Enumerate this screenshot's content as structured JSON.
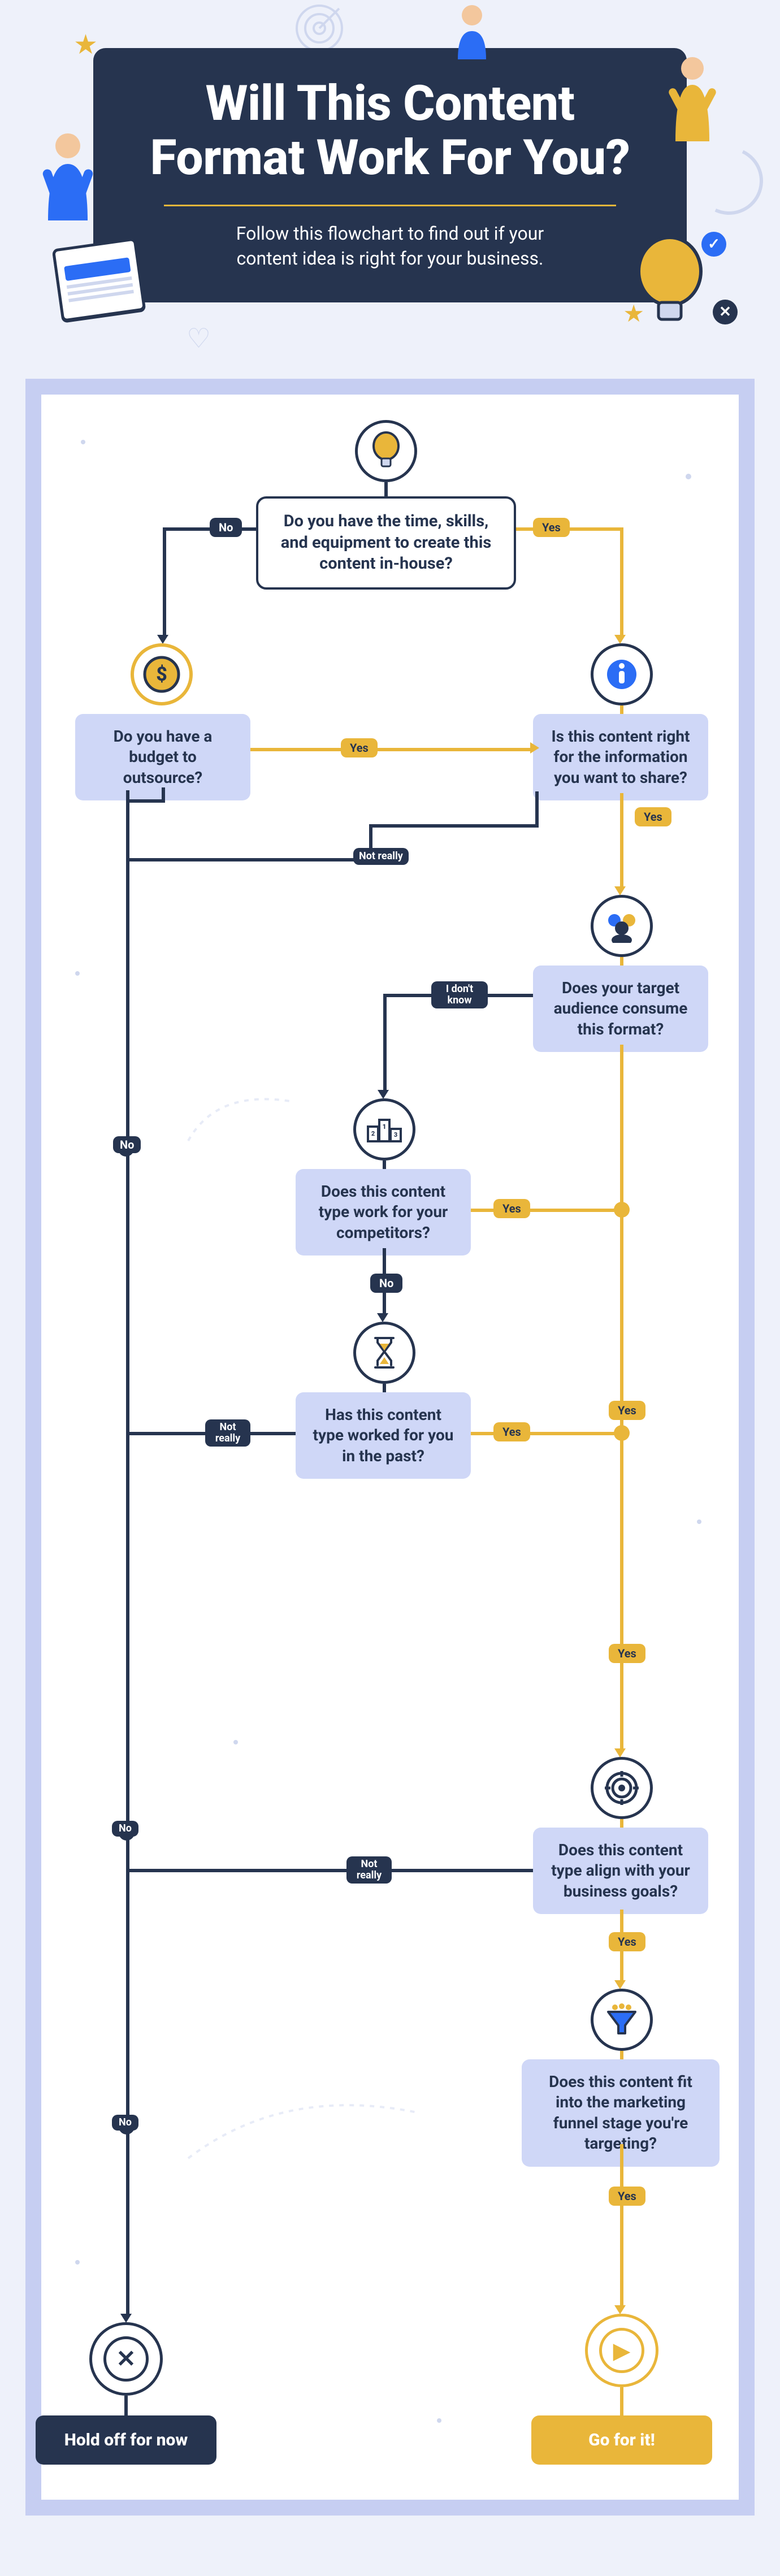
{
  "header": {
    "title_line1": "Will This Content",
    "title_line2": "Format Work For You?",
    "subtitle_line1": "Follow this flowchart to find out if your",
    "subtitle_line2": "content idea is right for your business."
  },
  "nodes": {
    "start": "Do you have the time, skills, and equipment to create this content in-house?",
    "budget": "Do you have a budget to outsource?",
    "info": "Is this content right for the information you want to share?",
    "audience": "Does your target audience consume this format?",
    "competitors": "Does this content type work for your competitors?",
    "past": "Has this content type worked for you in the past?",
    "goals": "Does this content type align with your business goals?",
    "funnel": "Does this content fit into the marketing funnel stage you're targeting?"
  },
  "answers": {
    "yes": "Yes",
    "no": "No",
    "not_really": "Not really",
    "idk": "I don't know"
  },
  "outcomes": {
    "hold": "Hold off for now",
    "go": "Go for it!"
  },
  "icons": {
    "bulb": "lightbulb",
    "dollar": "dollar-coin",
    "info": "info",
    "people": "people-group",
    "podium": "podium",
    "hourglass": "hourglass",
    "target": "target",
    "funnel": "funnel",
    "cross": "cross",
    "play": "play"
  }
}
